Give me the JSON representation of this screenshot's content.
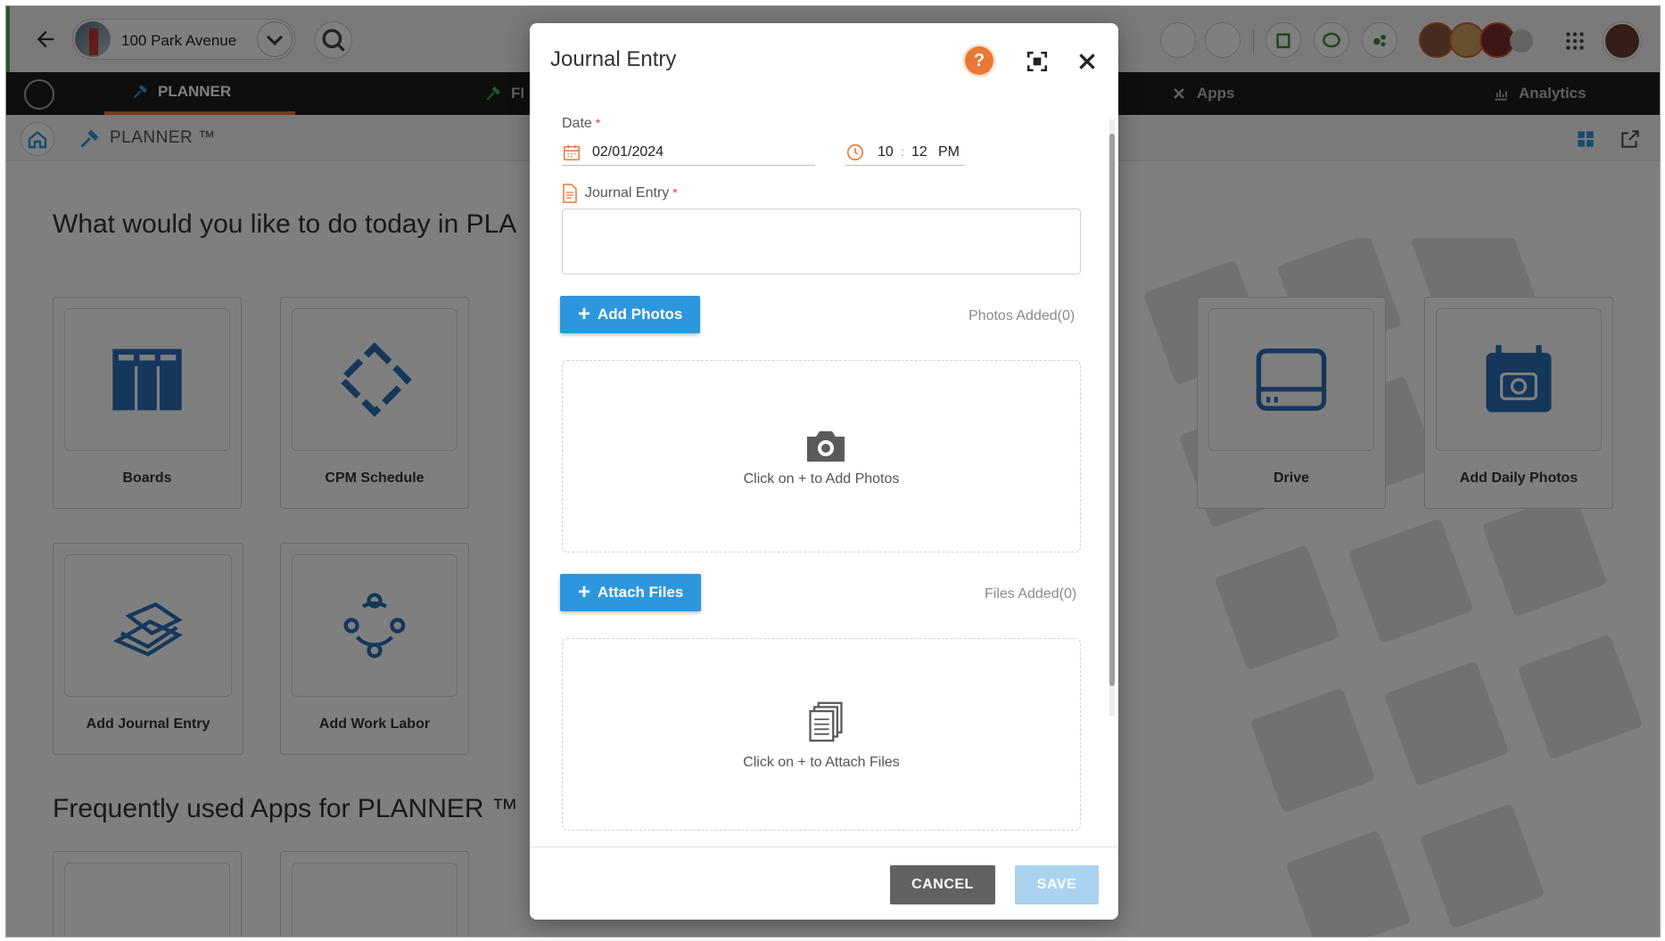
{
  "header": {
    "project_name": "100 Park Avenue"
  },
  "nav": {
    "items": [
      {
        "label": "PLANNER"
      },
      {
        "label": "FI"
      },
      {
        "label": "Apps"
      },
      {
        "label": "Analytics"
      }
    ]
  },
  "breadcrumb": {
    "title": "PLANNER ™"
  },
  "page": {
    "heading": "What would you like to do today in PLA",
    "frequent_heading": "Frequently used Apps for PLANNER ™",
    "cards": [
      {
        "label": "Boards"
      },
      {
        "label": "CPM Schedule"
      },
      {
        "label": "Drive"
      },
      {
        "label": "Add Daily Photos"
      },
      {
        "label": "Add Journal Entry"
      },
      {
        "label": "Add Work Labor"
      }
    ]
  },
  "modal": {
    "title": "Journal Entry",
    "help_symbol": "?",
    "date_label": "Date",
    "required_mark": "*",
    "date_value": "02/01/2024",
    "time_hour": "10",
    "time_sep": ":",
    "time_minute": "12",
    "time_ampm": "PM",
    "journal_label": "Journal Entry",
    "journal_value": "",
    "add_photos_label": "Add Photos",
    "photos_count": "Photos Added(0)",
    "photos_hint": "Click on + to Add Photos",
    "attach_files_label": "Attach Files",
    "files_count": "Files Added(0)",
    "files_hint": "Click on + to Attach Files",
    "plus_symbol": "+",
    "cancel_label": "CANCEL",
    "save_label": "SAVE"
  },
  "colors": {
    "accent_orange": "#e87935",
    "primary_blue": "#2d97de",
    "save_disabled_blue": "#a9d3f0",
    "cancel_gray": "#616161",
    "nav_dark": "#1c1c1c",
    "card_blue": "#2c6fb8"
  },
  "icons": {
    "back": "arrow-left-icon",
    "search": "search-icon",
    "calendar": "calendar-icon",
    "clock": "clock-icon",
    "camera": "camera-icon",
    "files": "files-stack-icon",
    "expand": "fullscreen-icon",
    "close": "close-icon"
  }
}
